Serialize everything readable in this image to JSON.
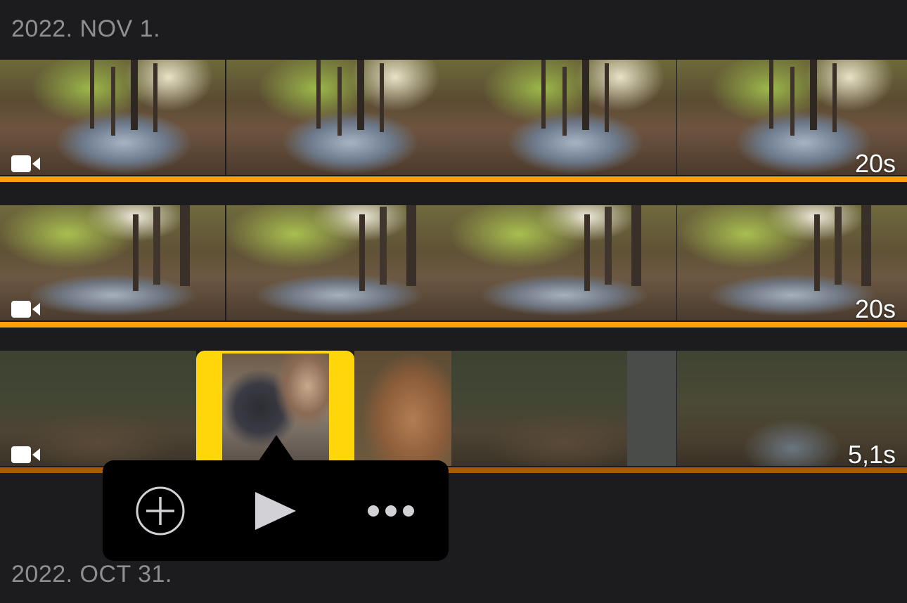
{
  "sections": [
    {
      "date": "2022. NOV 1."
    },
    {
      "date": "2022. OCT 31."
    }
  ],
  "clips": [
    {
      "duration": "20s",
      "icon": "video-camera-icon"
    },
    {
      "duration": "20s",
      "icon": "video-camera-icon"
    },
    {
      "duration": "5,1s",
      "icon": "video-camera-icon"
    }
  ],
  "popup": {
    "actions": [
      {
        "icon": "add-circle-icon"
      },
      {
        "icon": "play-icon"
      },
      {
        "icon": "more-icon"
      }
    ]
  },
  "colors": {
    "accent_orange": "#ff9f0a",
    "selection_yellow": "#ffd60a",
    "background": "#1c1c1e",
    "header_text": "#8e8e93"
  }
}
